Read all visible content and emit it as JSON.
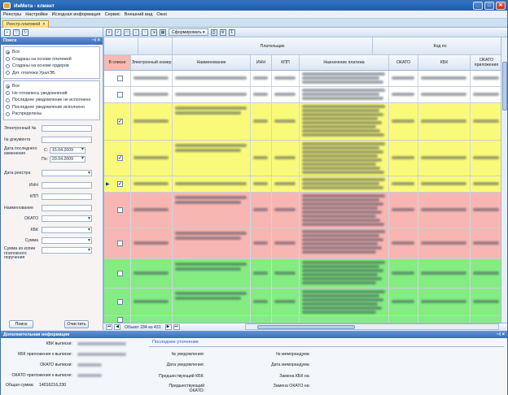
{
  "window": {
    "title": "ИнМета - клиент"
  },
  "menu": [
    "Реестры",
    "Настройки",
    "Исходная информация",
    "Сервис",
    "Внешний вид",
    "Окно"
  ],
  "doc_tab": {
    "label": "Реестр платежей"
  },
  "search": {
    "header": "Поиск",
    "group1": [
      "Все",
      "Созданы на основе платежей",
      "Созданы на основе ордеров",
      "Дет. платежи УралЭБ"
    ],
    "group2": [
      "Все",
      "Не готовлюсь уведомлений",
      "Последнее уведомление не исполнено",
      "Последнее уведомление исполнено",
      "Распределены"
    ],
    "fields": {
      "e_number": "Электронный №",
      "doc_number": "№ документа",
      "last_change_date": "Дата последнего изменения",
      "from_label": "С:",
      "to_label": "По:",
      "from_date": "15.04.2009",
      "to_date": "20.04.2009",
      "registry_date": "Дата реестра",
      "inn": "ИНН",
      "kpp": "КПП",
      "name": "Наименование",
      "okato": "ОКАТО",
      "kbk": "КБК",
      "sum": "Сумма",
      "sum_copy": "Сумма из копии платежного поручения"
    },
    "buttons": {
      "search": "Поиск",
      "clear": "Очистить"
    }
  },
  "toolbar": {
    "form_button": "Сформировать"
  },
  "grid": {
    "group_payer": "Плательщик",
    "group_code": "Код по",
    "columns": [
      "В списке",
      "Электронный номер",
      "Наименование",
      "ИНН",
      "КПП",
      "Назначение платежа",
      "ОКАТО",
      "КБК",
      "ОКАТО приложения"
    ],
    "rows": [
      {
        "color": "#ffffff",
        "checked": false,
        "current": false,
        "h": 20
      },
      {
        "color": "#ffffff",
        "checked": false,
        "current": false,
        "h": 20
      },
      {
        "color": "#fafa7a",
        "checked": true,
        "current": false,
        "h": 46
      },
      {
        "color": "#fafa7a",
        "checked": true,
        "current": false,
        "h": 44
      },
      {
        "color": "#fafa7a",
        "checked": true,
        "current": true,
        "h": 20
      },
      {
        "color": "#f8b6b2",
        "checked": false,
        "current": false,
        "h": 44
      },
      {
        "color": "#f8b6b2",
        "checked": false,
        "current": false,
        "h": 38
      },
      {
        "color": "#85ec83",
        "checked": false,
        "current": false,
        "h": 36
      },
      {
        "color": "#85ec83",
        "checked": false,
        "current": false,
        "h": 34
      },
      {
        "color": "#85ec83",
        "checked": false,
        "current": false,
        "h": 10
      }
    ]
  },
  "nav": {
    "record_text": "Объект 184 из 431"
  },
  "details": {
    "header": "Дополнительная информация",
    "left": {
      "kbk_out": "КБК выписки:",
      "kbk_app": "КБК приложения к выписке:",
      "okato_out": "ОКАТО выписки:",
      "okato_app": "ОКАТО приложения к выписке:",
      "total_label": "Общая сумма:",
      "total_value": "14016216,230"
    },
    "right": {
      "title": "Последнее уточнение",
      "notice_no": "№ уведомления:",
      "notice_date": "Дата уведомления:",
      "memo_no": "№ меморандума:",
      "memo_date": "Дата меморандума:",
      "prev_kbk": "Предшествующий КБК:",
      "prev_okato": "Предшествующий ОКАТО:",
      "kbk_change": "Замена КБК на:",
      "okato_change": "Замена ОКАТО на:"
    }
  }
}
